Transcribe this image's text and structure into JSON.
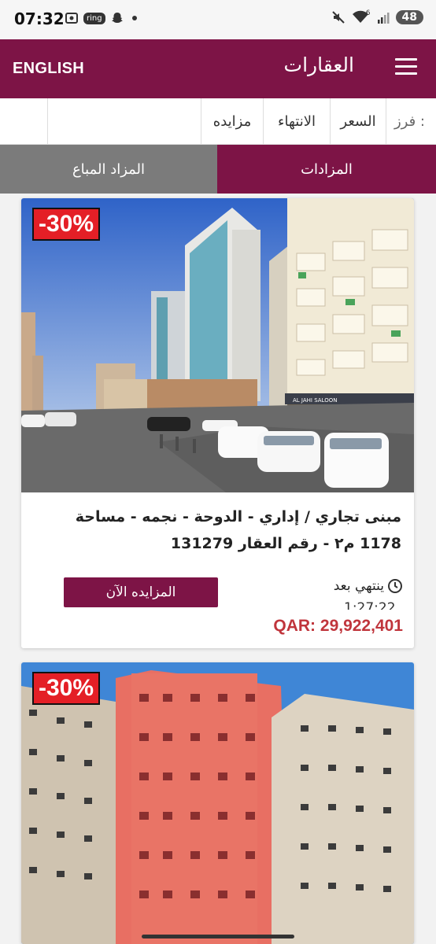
{
  "status_bar": {
    "time": "07:32",
    "ring_label": "ring",
    "battery": "48",
    "signal_label": "6"
  },
  "header": {
    "title": "العقارات",
    "language_button": "ENGLISH"
  },
  "sort_bar": {
    "label": "فرز :",
    "options": [
      "السعر",
      "الانتهاء",
      "مزايده"
    ]
  },
  "tabs": {
    "auctions": "المزادات",
    "sold_auctions": "المزاد المباع"
  },
  "listings": [
    {
      "discount": "-30%",
      "title": "مبنى تجاري / إداري - الدوحة - نجمه - مساحة 1178 م٢ - رقم العقار 131279",
      "bid_button": "المزايده الآن",
      "ends_label": "ينتهي بعد",
      "countdown": "1:27:22",
      "price": "QAR: 29,922,401",
      "image_shop_sign": "AL JAHI SALOON"
    },
    {
      "discount": "-30%"
    }
  ],
  "colors": {
    "brand": "#7d1446",
    "badge": "#e41f26",
    "price": "#c0353c",
    "tab_inactive": "#7b7b7b"
  }
}
